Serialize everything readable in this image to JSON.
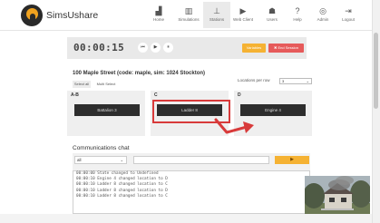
{
  "app": {
    "name": "SimsUshare"
  },
  "nav": {
    "items": [
      {
        "label": "Home",
        "icon": "home-icon",
        "glyph": "▟"
      },
      {
        "label": "Simulations",
        "icon": "map-icon",
        "glyph": "▥"
      },
      {
        "label": "Stations",
        "icon": "sitemap-icon",
        "glyph": "⊥",
        "active": true
      },
      {
        "label": "Web Client",
        "icon": "play-icon",
        "glyph": "▶"
      },
      {
        "label": "Users",
        "icon": "users-icon",
        "glyph": "☗"
      },
      {
        "label": "Help",
        "icon": "help-icon",
        "glyph": "?"
      },
      {
        "label": "Admin",
        "icon": "user-circle-icon",
        "glyph": "◎"
      },
      {
        "label": "Logout",
        "icon": "logout-icon",
        "glyph": "⇥"
      }
    ]
  },
  "timer": {
    "time": "00:00:15",
    "controls": [
      {
        "name": "rewind",
        "glyph": "⏮"
      },
      {
        "name": "play",
        "glyph": "▶"
      },
      {
        "name": "pause",
        "glyph": "⏸"
      }
    ],
    "variables_label": "Variables",
    "end_label": "✖ End Session"
  },
  "scenario": {
    "title": "100 Maple Street (code: maple, sim: 1024 Stockton)",
    "select_all": "Select all",
    "select_none": "Multi Select",
    "locations_label": "Locations per row",
    "locations_value": "3"
  },
  "columns": [
    {
      "label": "A-B",
      "units": [
        "Battalion 3"
      ]
    },
    {
      "label": "C",
      "units": [
        "Ladder 8"
      ]
    },
    {
      "label": "D",
      "units": [
        "Engine 4"
      ]
    }
  ],
  "comms": {
    "title": "Communications chat",
    "channel": "all",
    "send_glyph": "▶"
  },
  "log": [
    "00:00:00 State changed to Undefined",
    "00:00:10 Engine 4 changed location to D",
    "00:00:10 Ladder 8 changed location to C",
    "00:00:10 Ladder 8 changed location to D",
    "00:00:10 Ladder 8 changed location to C"
  ],
  "colors": {
    "accent_orange": "#f5b233",
    "accent_red": "#e65a5a",
    "highlight": "#d83a3a",
    "unit_bg": "#2d2d2d"
  }
}
